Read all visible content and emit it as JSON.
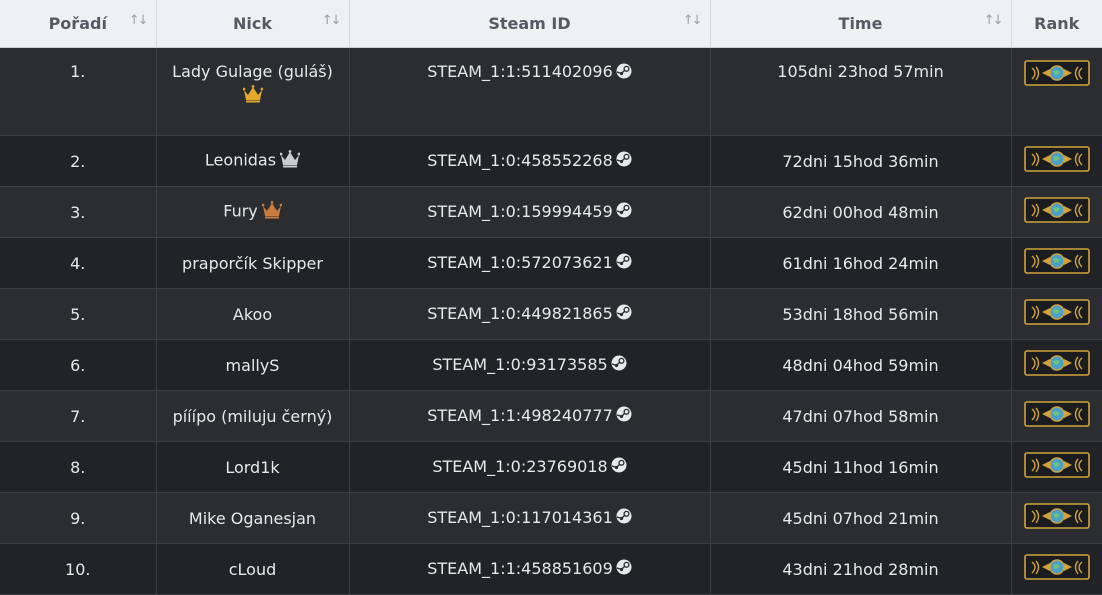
{
  "headers": {
    "rank_pos": "Pořadí",
    "nick": "Nick",
    "steam_id": "Steam ID",
    "time": "Time",
    "rank": "Rank"
  },
  "colors": {
    "crown_gold": "#e3a92c",
    "crown_silver": "#c9cdd2",
    "crown_bronze": "#c97a3c",
    "badge_gold": "#d2a33a"
  },
  "icons": {
    "sort": "sort-arrows-icon",
    "steam": "steam-logo-icon",
    "crown": "crown-icon",
    "rank_badge": "global-elite-badge-icon"
  },
  "rows": [
    {
      "pos": "1.",
      "nick": "Lady Gulage (guláš)",
      "crown": "gold",
      "steam_id": "STEAM_1:1:511402096",
      "time": "105dni 23hod 57min"
    },
    {
      "pos": "2.",
      "nick": "Leonidas",
      "crown": "silver",
      "steam_id": "STEAM_1:0:458552268",
      "time": "72dni 15hod 36min"
    },
    {
      "pos": "3.",
      "nick": "Fury",
      "crown": "bronze",
      "steam_id": "STEAM_1:0:159994459",
      "time": "62dni 00hod 48min"
    },
    {
      "pos": "4.",
      "nick": "praporčík Skipper",
      "crown": "",
      "steam_id": "STEAM_1:0:572073621",
      "time": "61dni 16hod 24min"
    },
    {
      "pos": "5.",
      "nick": "Akoo",
      "crown": "",
      "steam_id": "STEAM_1:0:449821865",
      "time": "53dni 18hod 56min"
    },
    {
      "pos": "6.",
      "nick": "mallyS",
      "crown": "",
      "steam_id": "STEAM_1:0:93173585",
      "time": "48dni 04hod 59min"
    },
    {
      "pos": "7.",
      "nick": "pííípo (miluju černý)",
      "crown": "",
      "steam_id": "STEAM_1:1:498240777",
      "time": "47dni 07hod 58min"
    },
    {
      "pos": "8.",
      "nick": "Lord1k",
      "crown": "",
      "steam_id": "STEAM_1:0:23769018",
      "time": "45dni 11hod 16min"
    },
    {
      "pos": "9.",
      "nick": "Mike Oganesjan",
      "crown": "",
      "steam_id": "STEAM_1:0:117014361",
      "time": "45dni 07hod 21min"
    },
    {
      "pos": "10.",
      "nick": "cLoud",
      "crown": "",
      "steam_id": "STEAM_1:1:458851609",
      "time": "43dni 21hod 28min"
    }
  ]
}
